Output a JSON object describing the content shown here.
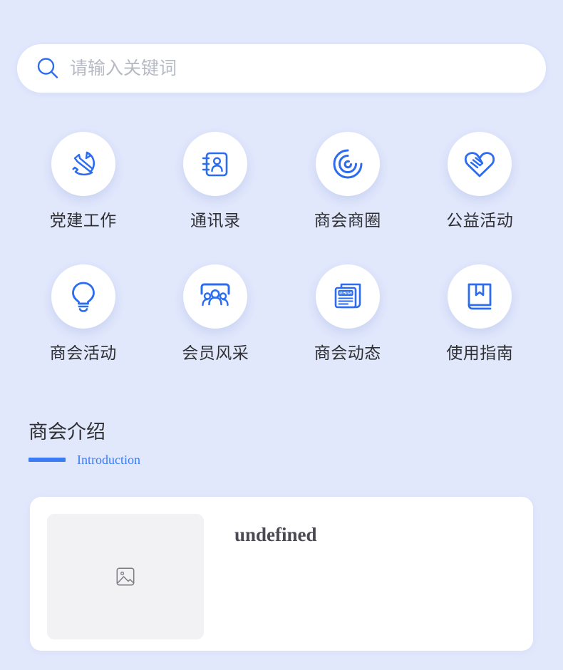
{
  "theme": {
    "background": "#e2e8fc",
    "accent": "#3b7cf5",
    "card_background": "#ffffff",
    "label_color": "#2f3033",
    "placeholder_color": "#b6bac4"
  },
  "search": {
    "icon": "search-icon",
    "value": "",
    "placeholder": "请输入关键词"
  },
  "grid": {
    "items": [
      {
        "label": "党建工作",
        "icon": "hammer-sickle-icon"
      },
      {
        "label": "通讯录",
        "icon": "address-book-icon"
      },
      {
        "label": "商会商圈",
        "icon": "spiral-circle-icon"
      },
      {
        "label": "公益活动",
        "icon": "heart-handshake-icon"
      },
      {
        "label": "商会活动",
        "icon": "lightbulb-icon"
      },
      {
        "label": "会员风采",
        "icon": "people-group-icon"
      },
      {
        "label": "商会动态",
        "icon": "newspaper-icon"
      },
      {
        "label": "使用指南",
        "icon": "book-bookmark-icon"
      }
    ]
  },
  "section": {
    "title": "商会介绍",
    "subtitle": "Introduction"
  },
  "intro_card": {
    "thumb_icon": "image-placeholder-icon",
    "title": "undefined",
    "description": ""
  }
}
